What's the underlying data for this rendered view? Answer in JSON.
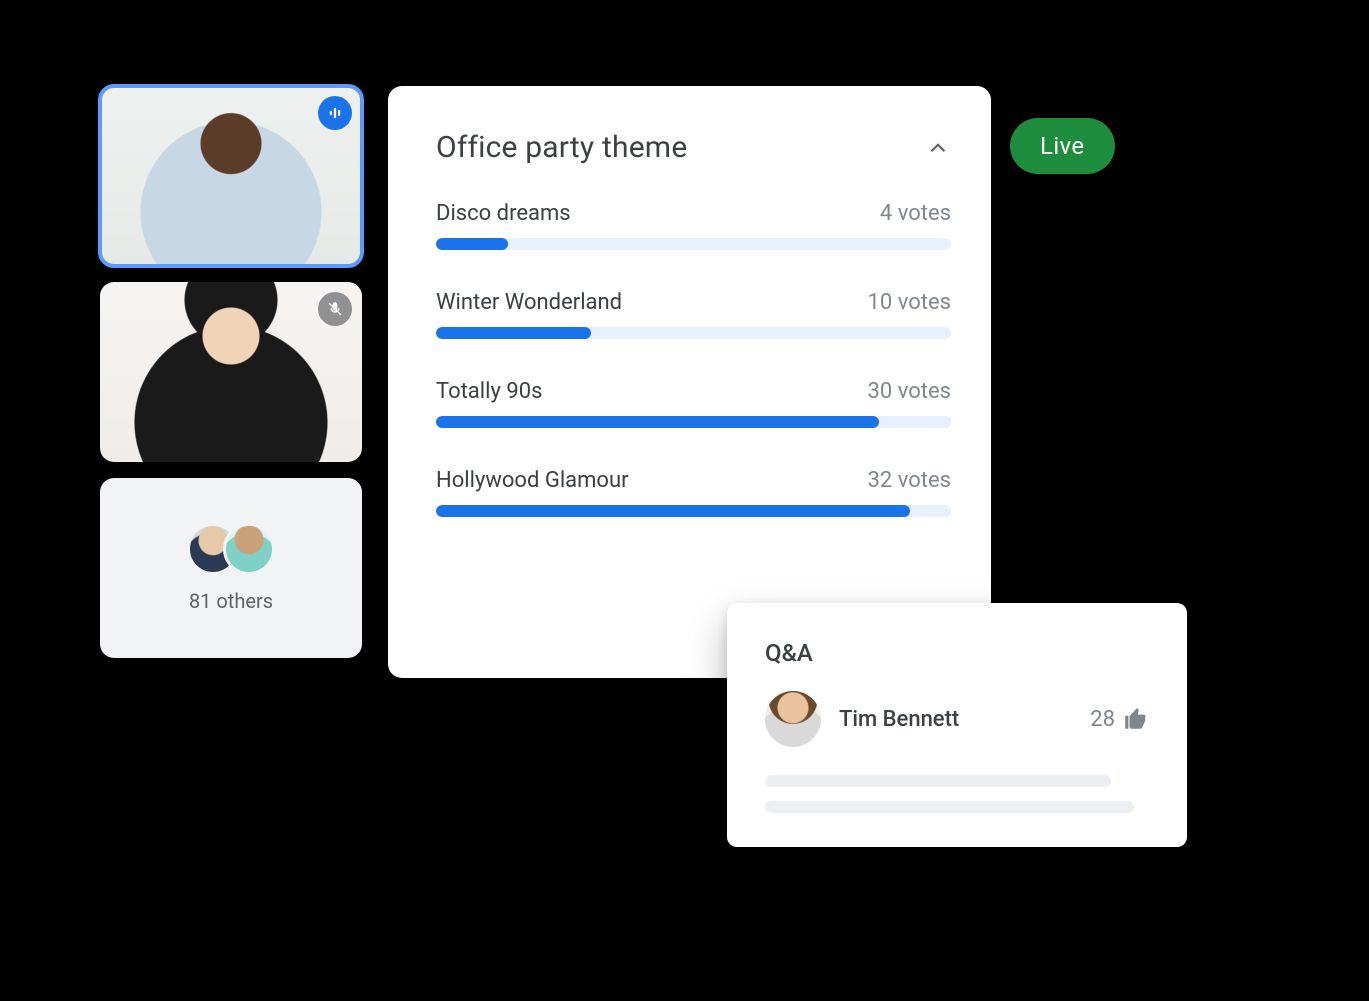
{
  "live_label": "Live",
  "participants": {
    "others_label": "81 others"
  },
  "poll": {
    "title": "Office party theme",
    "options": [
      {
        "label": "Disco dreams",
        "votes_text": "4 votes",
        "percent": 14
      },
      {
        "label": "Winter Wonderland",
        "votes_text": "10 votes",
        "percent": 30
      },
      {
        "label": "Totally 90s",
        "votes_text": "30 votes",
        "percent": 86
      },
      {
        "label": "Hollywood Glamour",
        "votes_text": "32 votes",
        "percent": 92
      }
    ]
  },
  "qa": {
    "title": "Q&A",
    "entry": {
      "author": "Tim Bennett",
      "upvotes": "28"
    }
  },
  "chart_data": {
    "type": "bar",
    "title": "Office party theme",
    "categories": [
      "Disco dreams",
      "Winter Wonderland",
      "Totally 90s",
      "Hollywood Glamour"
    ],
    "values": [
      4,
      10,
      30,
      32
    ],
    "xlabel": "",
    "ylabel": "votes",
    "ylim": [
      0,
      35
    ]
  }
}
